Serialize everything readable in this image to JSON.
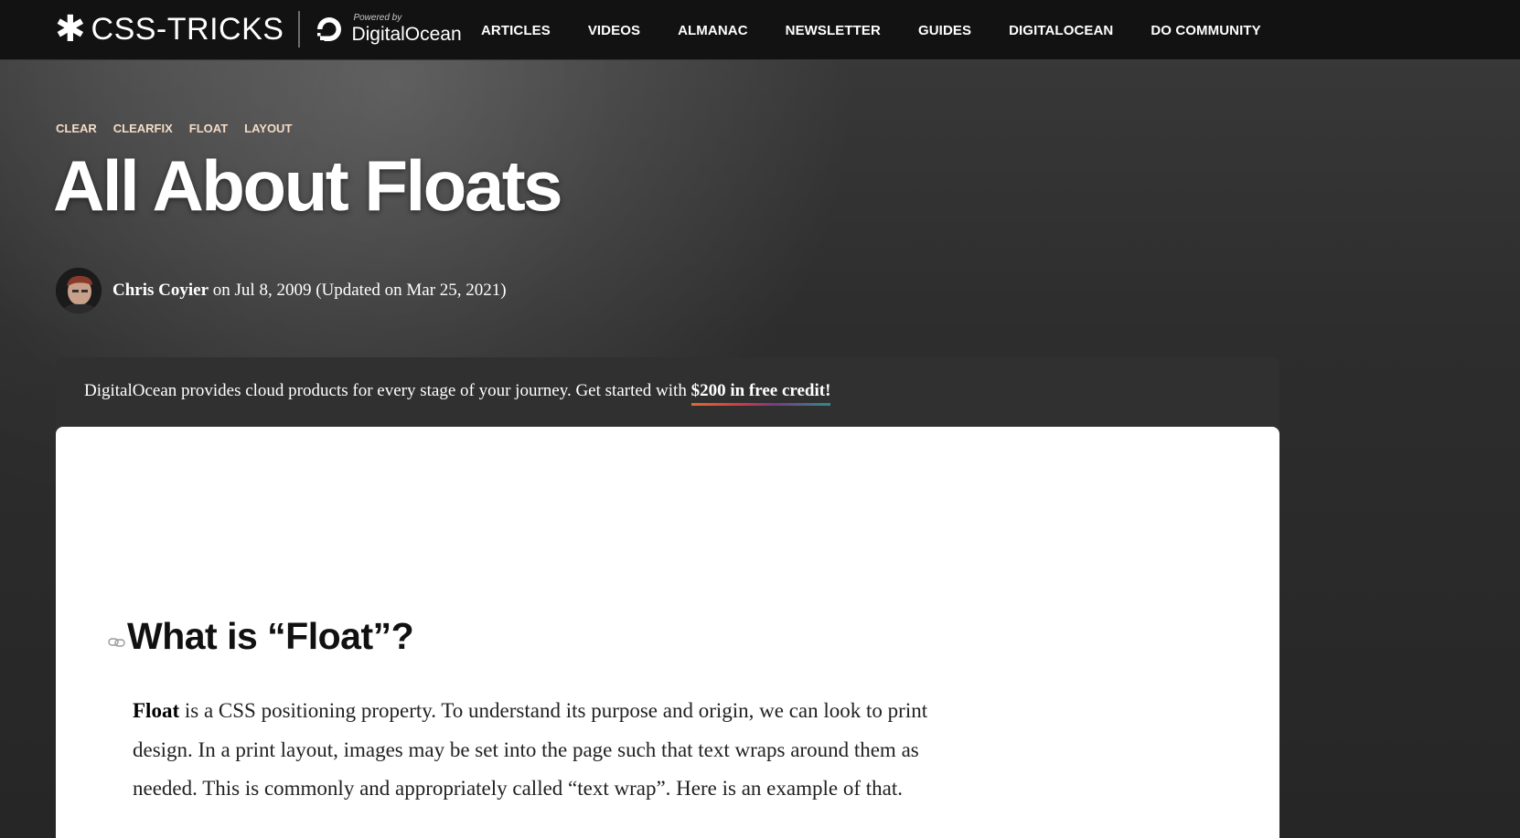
{
  "header": {
    "brand_name": "CSS-TRICKS",
    "brand_star": "✱",
    "powered_by": "Powered by",
    "partner_name": "DigitalOcean",
    "nav": [
      "ARTICLES",
      "VIDEOS",
      "ALMANAC",
      "NEWSLETTER",
      "GUIDES",
      "DIGITALOCEAN",
      "DO COMMUNITY"
    ]
  },
  "article": {
    "tags": [
      "CLEAR",
      "CLEARFIX",
      "FLOAT",
      "LAYOUT"
    ],
    "title": "All About Floats",
    "author": "Chris Coyier",
    "date_text": "on Jul 8, 2009 (Updated on Mar 25, 2021)"
  },
  "sponsor": {
    "text": "DigitalOcean provides cloud products for every stage of your journey. Get started with ",
    "link": "$200 in free credit!"
  },
  "content": {
    "heading": "What is “Float”?",
    "para_bold": "Float",
    "para_rest": " is a CSS positioning property. To understand its purpose and origin, we can look to print design. In a print layout, images may be set into the page such that text wraps around them as needed. This is commonly and appropriately called “text wrap”. Here is an example of that."
  },
  "colors": {
    "nav_bg": "#121212",
    "tag": "#f3dcc6",
    "link_gradient": [
      "#e06c2a",
      "#d13a48",
      "#7a3b7e",
      "#2e8b8b"
    ]
  },
  "icons": {
    "brand": "asterisk-icon",
    "partner": "digitalocean-logo",
    "heading_anchor": "link-icon"
  }
}
